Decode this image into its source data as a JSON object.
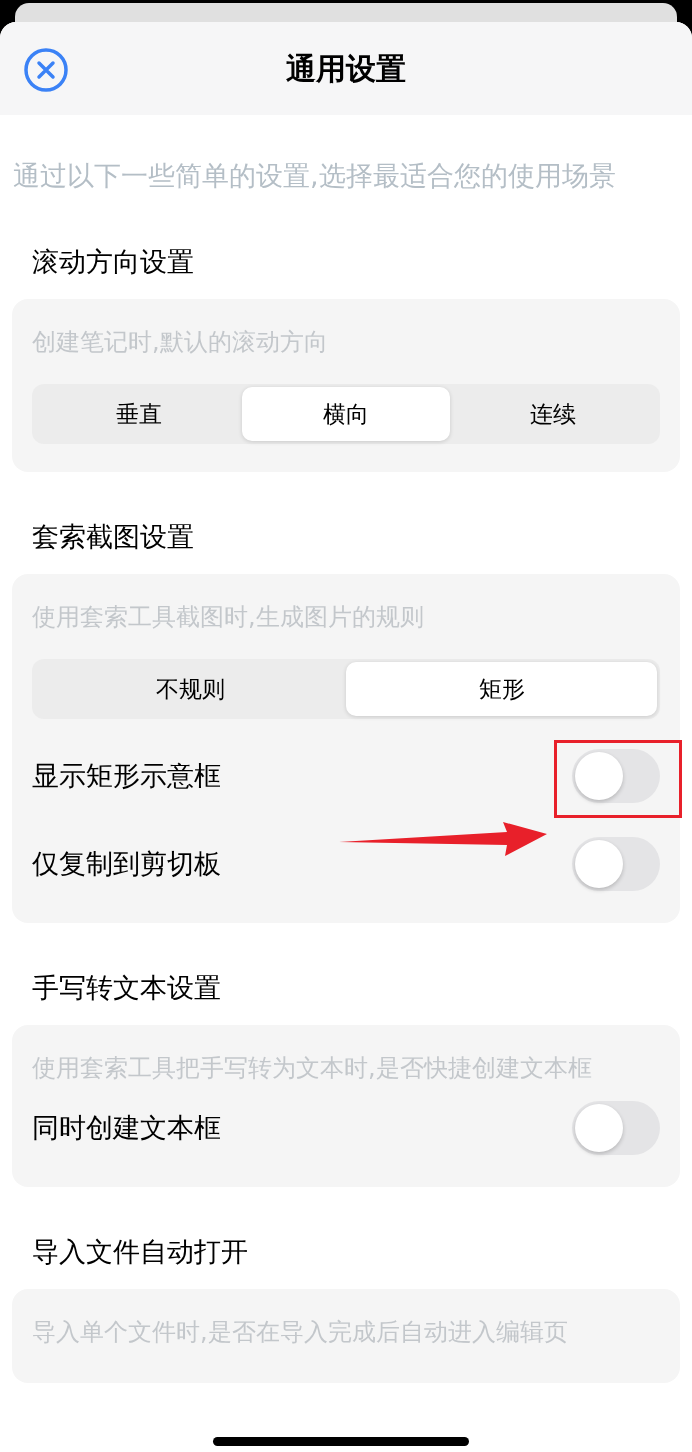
{
  "header": {
    "title": "通用设置"
  },
  "intro": "通过以下一些简单的设置,选择最适合您的使用场景",
  "sections": [
    {
      "title": "滚动方向设置",
      "description": "创建笔记时,默认的滚动方向",
      "segments": [
        {
          "label": "垂直",
          "selected": false
        },
        {
          "label": "横向",
          "selected": true
        },
        {
          "label": "连续",
          "selected": false
        }
      ]
    },
    {
      "title": "套索截图设置",
      "description": "使用套索工具截图时,生成图片的规则",
      "segments": [
        {
          "label": "不规则",
          "selected": false
        },
        {
          "label": "矩形",
          "selected": true
        }
      ],
      "toggles": [
        {
          "label": "显示矩形示意框",
          "on": false
        },
        {
          "label": "仅复制到剪切板",
          "on": false
        }
      ]
    },
    {
      "title": "手写转文本设置",
      "description": "使用套索工具把手写转为文本时,是否快捷创建文本框",
      "toggles": [
        {
          "label": "同时创建文本框",
          "on": false
        }
      ]
    },
    {
      "title": "导入文件自动打开",
      "description": "导入单个文件时,是否在导入完成后自动进入编辑页"
    }
  ]
}
